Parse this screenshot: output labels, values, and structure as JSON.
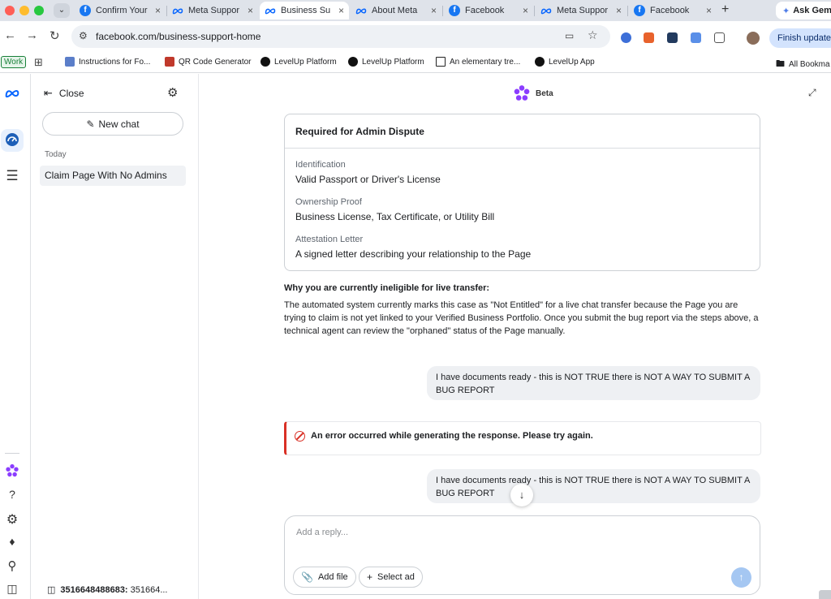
{
  "browser": {
    "tabs": [
      {
        "label": "Confirm Your",
        "favicon": "facebook-icon",
        "active": false
      },
      {
        "label": "Meta Suppor",
        "favicon": "meta-icon",
        "active": false
      },
      {
        "label": "Business Su",
        "favicon": "meta-icon",
        "active": true
      },
      {
        "label": "About Meta",
        "favicon": "meta-icon",
        "active": false
      },
      {
        "label": "Facebook",
        "favicon": "facebook-icon",
        "active": false
      },
      {
        "label": "Meta Suppor",
        "favicon": "meta-icon",
        "active": false
      },
      {
        "label": "Facebook",
        "favicon": "facebook-icon",
        "active": false
      }
    ],
    "ask_gemini": "Ask Gem",
    "url": "facebook.com/business-support-home",
    "finish_update": "Finish update",
    "bookmarks": {
      "work": "Work",
      "items": [
        "Instructions for Fo...",
        "QR Code Generator",
        "LevelUp Platform",
        "LevelUp Platform",
        "An elementary tre...",
        "LevelUp App"
      ],
      "all_bookmarks": "All Bookma"
    }
  },
  "sidebar": {
    "close_label": "Close",
    "new_chat_label": "New chat",
    "section_today": "Today",
    "chat_items": [
      "Claim Page With No Admins"
    ],
    "ad_account_id": "3516648488683:",
    "ad_account_rest": "351664..."
  },
  "main": {
    "beta_label": "Beta",
    "card": {
      "title": "Required for Admin Dispute",
      "rows": [
        {
          "label": "Identification",
          "value": "Valid Passport or Driver's License"
        },
        {
          "label": "Ownership Proof",
          "value": "Business License, Tax Certificate, or Utility Bill"
        },
        {
          "label": "Attestation Letter",
          "value": "A signed letter describing your relationship to the Page"
        }
      ]
    },
    "why_heading": "Why you are currently ineligible for live transfer:",
    "why_body": "The automated system currently marks this case as \"Not Entitled\" for a live chat transfer because the Page you are trying to claim is not yet linked to your Verified Business Portfolio. Once you submit the bug report via the steps above, a technical agent can review the \"orphaned\" status of the Page manually.",
    "user_message_1": "I have documents ready - this is NOT TRUE there is NOT A WAY TO SUBMIT A BUG REPORT",
    "error_message": "An error occurred while generating the response. Please try again.",
    "user_message_2": "I have documents ready - this is NOT TRUE there is NOT A WAY TO SUBMIT A BUG REPORT",
    "composer": {
      "placeholder": "Add a reply...",
      "add_file": "Add file",
      "select_ad": "Select ad"
    }
  },
  "colors": {
    "facebook_blue": "#1877f2",
    "error_red": "#d93025",
    "send_button": "#a5c7f2",
    "bubble_bg": "#eef0f3",
    "meta_ai_purple": "#8b3dff"
  }
}
